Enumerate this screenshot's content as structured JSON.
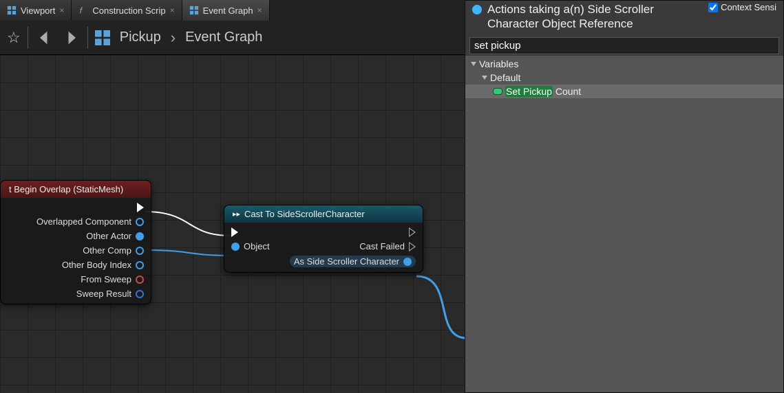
{
  "tabs": [
    {
      "label": "Viewport",
      "icon": "viewport"
    },
    {
      "label": "Construction Scrip",
      "icon": "function"
    },
    {
      "label": "Event Graph",
      "icon": "graph",
      "active": true
    }
  ],
  "toolbar": {
    "breadcrumb": {
      "root": "Pickup",
      "current": "Event Graph"
    }
  },
  "nodes": {
    "event": {
      "title": "t Begin Overlap (StaticMesh)",
      "pins": {
        "overlapped": "Overlapped Component",
        "other_actor": "Other Actor",
        "other_comp": "Other Comp",
        "other_body": "Other Body Index",
        "from_sweep": "From Sweep",
        "sweep_result": "Sweep Result"
      }
    },
    "cast": {
      "title": "Cast To SideScrollerCharacter",
      "pins": {
        "object": "Object",
        "cast_failed": "Cast Failed",
        "as_char": "As Side Scroller Character"
      }
    }
  },
  "context_menu": {
    "title_line1": "Actions taking a(n) Side Scroller",
    "title_line2": "Character Object Reference",
    "search_value": "set pickup",
    "context_sensitive_label": "Context Sensi",
    "category_root": "Variables",
    "category_sub": "Default",
    "result_prefix": "Set Pickup",
    "result_suffix": " Count"
  }
}
